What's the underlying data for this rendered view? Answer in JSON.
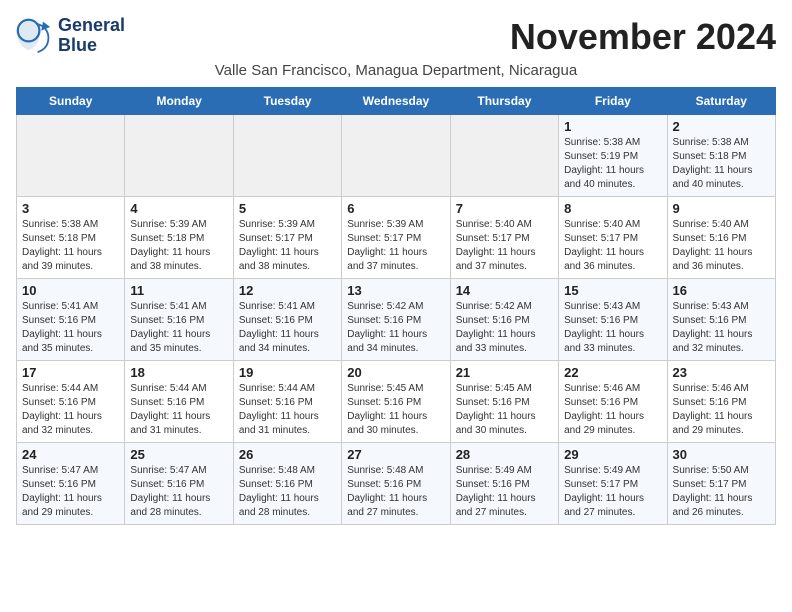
{
  "logo": {
    "line1": "General",
    "line2": "Blue"
  },
  "title": "November 2024",
  "subtitle": "Valle San Francisco, Managua Department, Nicaragua",
  "days_header": [
    "Sunday",
    "Monday",
    "Tuesday",
    "Wednesday",
    "Thursday",
    "Friday",
    "Saturday"
  ],
  "weeks": [
    [
      {
        "day": "",
        "info": ""
      },
      {
        "day": "",
        "info": ""
      },
      {
        "day": "",
        "info": ""
      },
      {
        "day": "",
        "info": ""
      },
      {
        "day": "",
        "info": ""
      },
      {
        "day": "1",
        "info": "Sunrise: 5:38 AM\nSunset: 5:19 PM\nDaylight: 11 hours and 40 minutes."
      },
      {
        "day": "2",
        "info": "Sunrise: 5:38 AM\nSunset: 5:18 PM\nDaylight: 11 hours and 40 minutes."
      }
    ],
    [
      {
        "day": "3",
        "info": "Sunrise: 5:38 AM\nSunset: 5:18 PM\nDaylight: 11 hours and 39 minutes."
      },
      {
        "day": "4",
        "info": "Sunrise: 5:39 AM\nSunset: 5:18 PM\nDaylight: 11 hours and 38 minutes."
      },
      {
        "day": "5",
        "info": "Sunrise: 5:39 AM\nSunset: 5:17 PM\nDaylight: 11 hours and 38 minutes."
      },
      {
        "day": "6",
        "info": "Sunrise: 5:39 AM\nSunset: 5:17 PM\nDaylight: 11 hours and 37 minutes."
      },
      {
        "day": "7",
        "info": "Sunrise: 5:40 AM\nSunset: 5:17 PM\nDaylight: 11 hours and 37 minutes."
      },
      {
        "day": "8",
        "info": "Sunrise: 5:40 AM\nSunset: 5:17 PM\nDaylight: 11 hours and 36 minutes."
      },
      {
        "day": "9",
        "info": "Sunrise: 5:40 AM\nSunset: 5:16 PM\nDaylight: 11 hours and 36 minutes."
      }
    ],
    [
      {
        "day": "10",
        "info": "Sunrise: 5:41 AM\nSunset: 5:16 PM\nDaylight: 11 hours and 35 minutes."
      },
      {
        "day": "11",
        "info": "Sunrise: 5:41 AM\nSunset: 5:16 PM\nDaylight: 11 hours and 35 minutes."
      },
      {
        "day": "12",
        "info": "Sunrise: 5:41 AM\nSunset: 5:16 PM\nDaylight: 11 hours and 34 minutes."
      },
      {
        "day": "13",
        "info": "Sunrise: 5:42 AM\nSunset: 5:16 PM\nDaylight: 11 hours and 34 minutes."
      },
      {
        "day": "14",
        "info": "Sunrise: 5:42 AM\nSunset: 5:16 PM\nDaylight: 11 hours and 33 minutes."
      },
      {
        "day": "15",
        "info": "Sunrise: 5:43 AM\nSunset: 5:16 PM\nDaylight: 11 hours and 33 minutes."
      },
      {
        "day": "16",
        "info": "Sunrise: 5:43 AM\nSunset: 5:16 PM\nDaylight: 11 hours and 32 minutes."
      }
    ],
    [
      {
        "day": "17",
        "info": "Sunrise: 5:44 AM\nSunset: 5:16 PM\nDaylight: 11 hours and 32 minutes."
      },
      {
        "day": "18",
        "info": "Sunrise: 5:44 AM\nSunset: 5:16 PM\nDaylight: 11 hours and 31 minutes."
      },
      {
        "day": "19",
        "info": "Sunrise: 5:44 AM\nSunset: 5:16 PM\nDaylight: 11 hours and 31 minutes."
      },
      {
        "day": "20",
        "info": "Sunrise: 5:45 AM\nSunset: 5:16 PM\nDaylight: 11 hours and 30 minutes."
      },
      {
        "day": "21",
        "info": "Sunrise: 5:45 AM\nSunset: 5:16 PM\nDaylight: 11 hours and 30 minutes."
      },
      {
        "day": "22",
        "info": "Sunrise: 5:46 AM\nSunset: 5:16 PM\nDaylight: 11 hours and 29 minutes."
      },
      {
        "day": "23",
        "info": "Sunrise: 5:46 AM\nSunset: 5:16 PM\nDaylight: 11 hours and 29 minutes."
      }
    ],
    [
      {
        "day": "24",
        "info": "Sunrise: 5:47 AM\nSunset: 5:16 PM\nDaylight: 11 hours and 29 minutes."
      },
      {
        "day": "25",
        "info": "Sunrise: 5:47 AM\nSunset: 5:16 PM\nDaylight: 11 hours and 28 minutes."
      },
      {
        "day": "26",
        "info": "Sunrise: 5:48 AM\nSunset: 5:16 PM\nDaylight: 11 hours and 28 minutes."
      },
      {
        "day": "27",
        "info": "Sunrise: 5:48 AM\nSunset: 5:16 PM\nDaylight: 11 hours and 27 minutes."
      },
      {
        "day": "28",
        "info": "Sunrise: 5:49 AM\nSunset: 5:16 PM\nDaylight: 11 hours and 27 minutes."
      },
      {
        "day": "29",
        "info": "Sunrise: 5:49 AM\nSunset: 5:17 PM\nDaylight: 11 hours and 27 minutes."
      },
      {
        "day": "30",
        "info": "Sunrise: 5:50 AM\nSunset: 5:17 PM\nDaylight: 11 hours and 26 minutes."
      }
    ]
  ]
}
